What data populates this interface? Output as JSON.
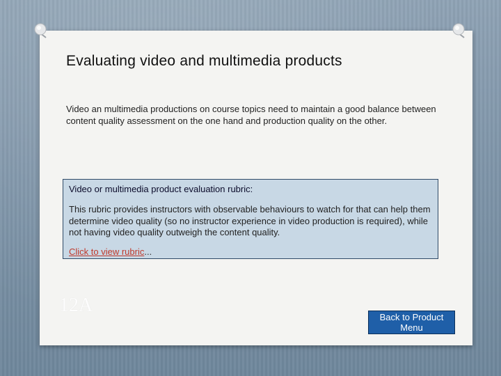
{
  "slide": {
    "title": "Evaluating video and multimedia products",
    "intro": "Video an multimedia productions on course topics need to maintain a good balance between content quality assessment on the one hand and production quality on the other.",
    "rubric": {
      "heading": "Video or multimedia product evaluation rubric:",
      "text": "This rubric provides instructors with observable behaviours to watch for that can help them determine video quality (so no instructor experience in video production is required), while not having video quality outweigh the content quality.",
      "link_label": "Click to view rubric",
      "link_suffix": "..."
    },
    "slide_number": "12A",
    "back_button": "Back to Product Menu"
  },
  "colors": {
    "background": "#7f95a9",
    "panel": "#f4f4f2",
    "rubric_box": "#c8d8e5",
    "link": "#c0392b",
    "button": "#1f5fa8"
  },
  "icons": [
    "pushpin-icon"
  ]
}
